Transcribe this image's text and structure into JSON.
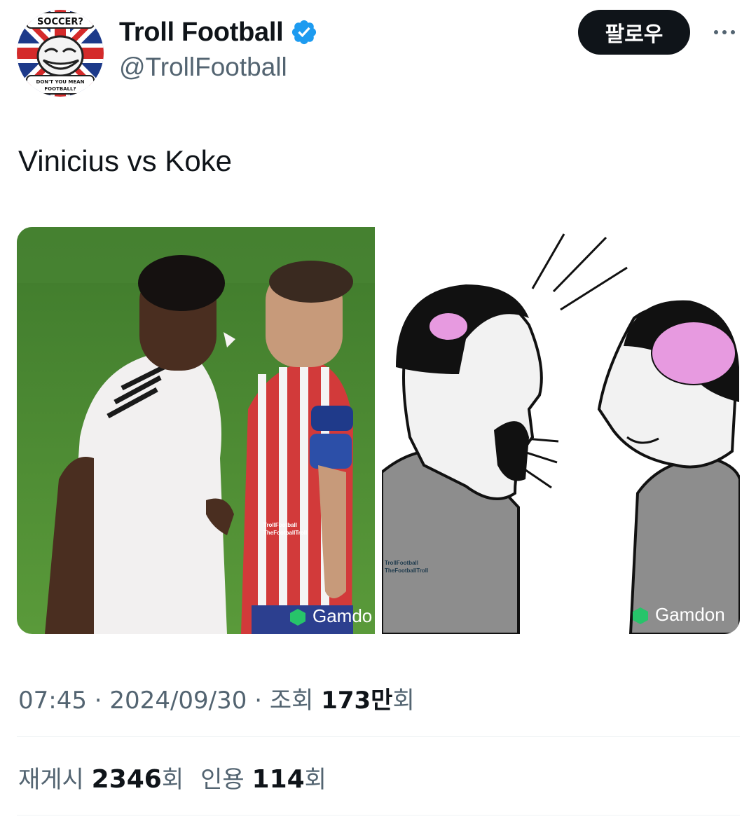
{
  "user": {
    "display_name": "Troll Football",
    "handle": "@TrollFootball",
    "avatar_text_top": "SOCCER?",
    "avatar_text_bottom_1": "DON'T YOU MEAN",
    "avatar_text_bottom_2": "FOOTBALL?",
    "verified": true
  },
  "follow_button": {
    "label": "팔로우"
  },
  "more_button": {
    "icon": "more-horizontal-icon"
  },
  "tweet": {
    "text": "Vinicius vs Koke"
  },
  "media": {
    "left_watermark_line1": "TrollFootball",
    "left_watermark_line2": "TheFootballTroll",
    "left_brand": "Gamdo",
    "right_watermark_line1": "TrollFootball",
    "right_watermark_line2": "TheFootballTroll",
    "right_brand": "Gamdon"
  },
  "meta": {
    "time": "07:45",
    "separator": "·",
    "date": "2024/09/30",
    "views_label": "조회",
    "views_value": "173만",
    "views_unit": "회"
  },
  "stats": {
    "reposts_label": "재게시",
    "reposts_value": "2346",
    "reposts_unit": "회",
    "quotes_label": "인용",
    "quotes_value": "114",
    "quotes_unit": "회"
  },
  "colors": {
    "text_primary": "#0f1419",
    "text_secondary": "#536471",
    "verified_blue": "#1d9bf0",
    "follow_bg": "#0f1419",
    "divider": "#eff3f4"
  }
}
